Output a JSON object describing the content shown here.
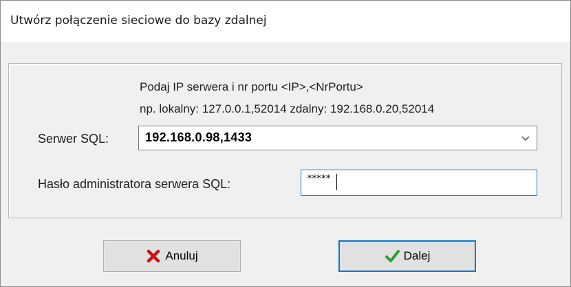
{
  "window": {
    "title": "Utwórz połączenie sieciowe do bazy zdalnej"
  },
  "hint": {
    "line1": "Podaj IP serwera i nr portu <IP>,<NrPortu>",
    "line2": "np. lokalny: 127.0.0.1,52014  zdalny: 192.168.0.20,52014"
  },
  "server": {
    "label": "Serwer SQL:",
    "value": "192.168.0.98,1433",
    "icon": "chevron-down-icon"
  },
  "password": {
    "label": "Hasło administratora serwera SQL:",
    "masked_value": "*****"
  },
  "buttons": {
    "cancel": {
      "label": "Anuluj",
      "icon": "red-x-icon"
    },
    "next": {
      "label": "Dalej",
      "icon": "green-check-icon"
    }
  },
  "colors": {
    "focus_border": "#0078d7",
    "cancel_icon": "#cc1111",
    "next_icon": "#2ea02e"
  }
}
